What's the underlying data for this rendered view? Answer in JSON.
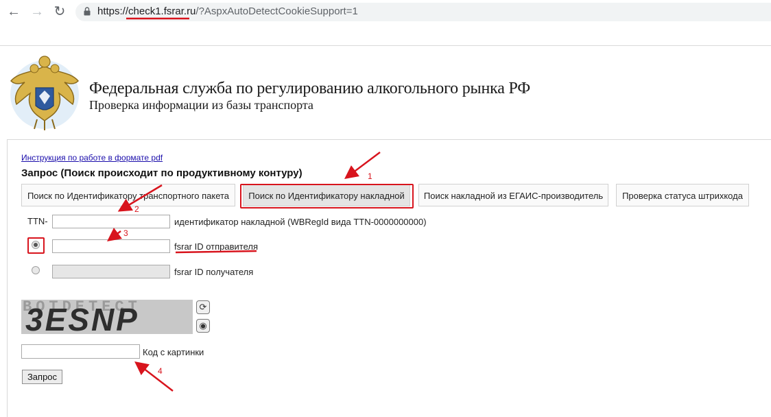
{
  "browser": {
    "url_host": "check1.fsrar.ru",
    "url_scheme": "https://",
    "url_rest": "/?AspxAutoDetectCookieSupport=1"
  },
  "header": {
    "title": "Федеральная служба по регулированию алкогольного рынка РФ",
    "subtitle": "Проверка информации из базы транспорта"
  },
  "main": {
    "instruction_link": "Инструкция по работе в формате pdf",
    "query_title": "Запрос (Поиск происходит по продуктивному контуру)",
    "tabs": [
      {
        "label": "Поиск по Идентификатору транспортного пакета",
        "active": false
      },
      {
        "label": "Поиск по Идентификатору накладной",
        "active": true
      },
      {
        "label": "Поиск накладной из ЕГАИС-производитель",
        "active": false
      },
      {
        "label": "Проверка статуса штрихкода",
        "active": false
      }
    ],
    "form": {
      "ttn_prefix": "TTN-",
      "ttn_hint": "идентификатор накладной (WBRegId вида TTN-0000000000)",
      "sender_label": "fsrar ID отправителя",
      "receiver_label": "fsrar ID получателя",
      "selected_radio": "sender",
      "captcha_text": "3ESNP",
      "captcha_bg_text": "BOTDETECT",
      "captcha_label": "Код с картинки",
      "submit_label": "Запрос"
    }
  },
  "annotations": [
    "1",
    "2",
    "3",
    "4"
  ],
  "colors": {
    "annotation": "#d8141d",
    "link": "#1a0dab"
  }
}
